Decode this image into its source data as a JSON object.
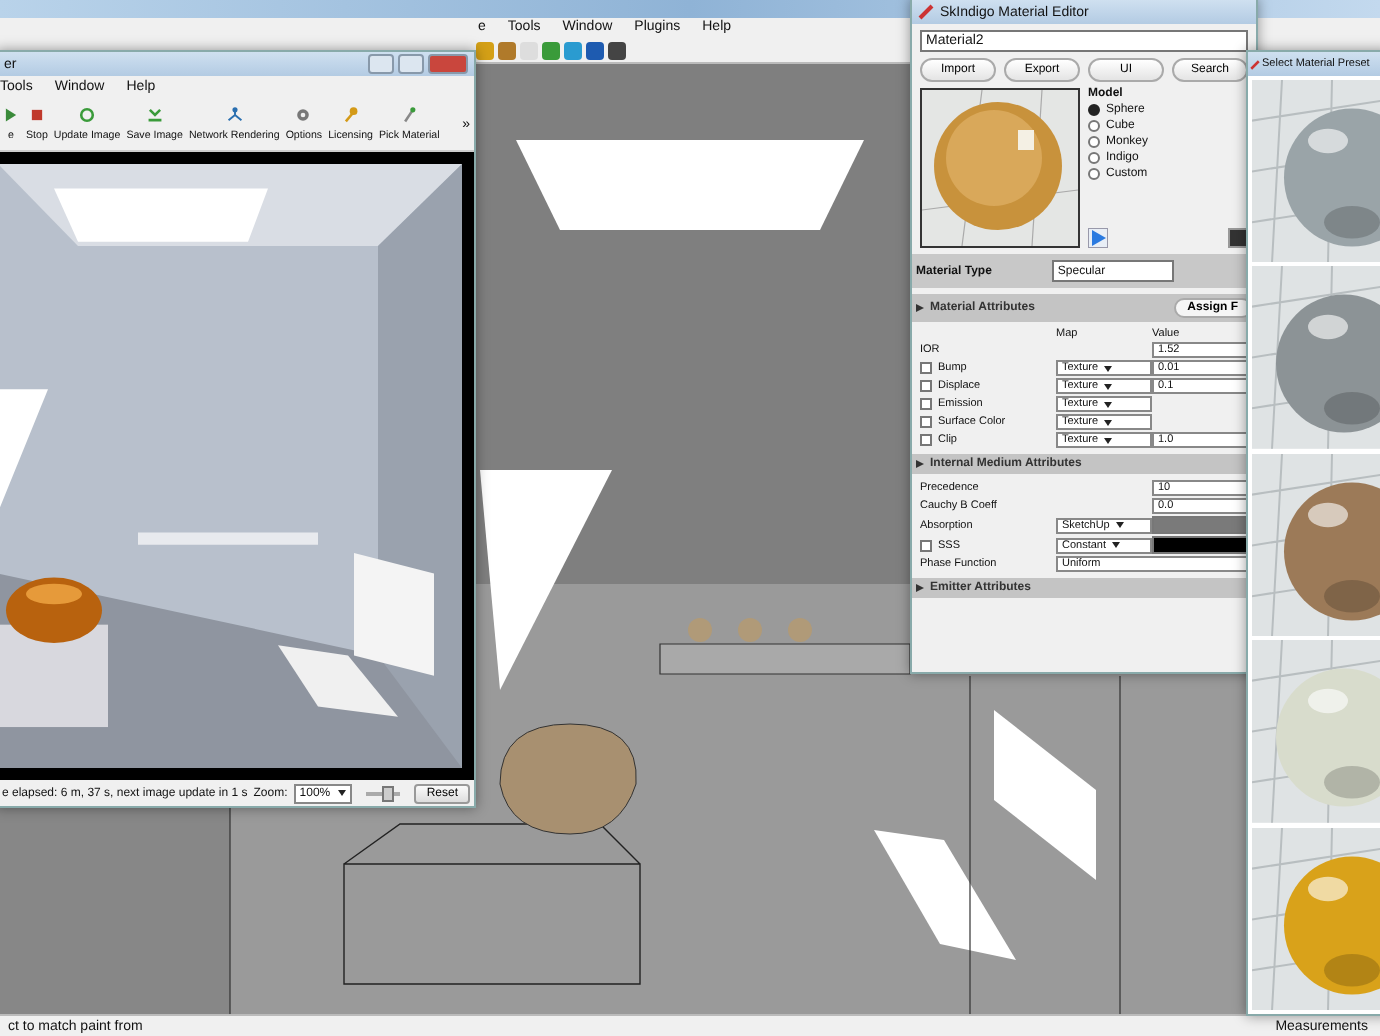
{
  "app": {
    "menu": [
      "e",
      "Tools",
      "Window",
      "Plugins",
      "Help"
    ],
    "status": "ct to match paint from",
    "measurements": "Measurements"
  },
  "render_window": {
    "title": "er",
    "menu": [
      "Tools",
      "Window",
      "Help"
    ],
    "toolbar": [
      {
        "label": "e",
        "kind": "play"
      },
      {
        "label": "Stop",
        "kind": "stop"
      },
      {
        "label": "Update Image",
        "kind": "refresh"
      },
      {
        "label": "Save Image",
        "kind": "save"
      },
      {
        "label": "Network Rendering",
        "kind": "network"
      },
      {
        "label": "Options",
        "kind": "gear"
      },
      {
        "label": "Licensing",
        "kind": "key"
      },
      {
        "label": "Pick Material",
        "kind": "pick"
      }
    ],
    "more": "»",
    "status": "e elapsed: 6 m, 37 s, next image update in 1 s",
    "zoom_label": "Zoom:",
    "zoom": "100%",
    "zoom_slider": {
      "level": 0.55
    },
    "reset": "Reset"
  },
  "material_editor": {
    "title": "SkIndigo Material Editor",
    "material": "Material2",
    "buttons": [
      "Import",
      "Export",
      "UI",
      "Search"
    ],
    "model_label": "Model",
    "models": [
      {
        "label": "Sphere",
        "selected": true
      },
      {
        "label": "Cube",
        "selected": false
      },
      {
        "label": "Monkey",
        "selected": false
      },
      {
        "label": "Indigo",
        "selected": false
      },
      {
        "label": "Custom",
        "selected": false
      }
    ],
    "type_label": "Material Type",
    "type": "Specular",
    "attributes": {
      "title": "Material Attributes",
      "assign": "Assign F",
      "map_header": "Map",
      "value_header": "Value",
      "rows": [
        {
          "label": "IOR",
          "value": "1.52"
        },
        {
          "label": "Bump",
          "checked": false,
          "map": "Texture",
          "value": "0.01"
        },
        {
          "label": "Displace",
          "checked": false,
          "map": "Texture",
          "value": "0.1"
        },
        {
          "label": "Emission",
          "checked": false,
          "map": "Texture"
        },
        {
          "label": "Surface Color",
          "checked": false,
          "map": "Texture"
        },
        {
          "label": "Clip",
          "checked": false,
          "map": "Texture",
          "value": "1.0"
        }
      ]
    },
    "medium": {
      "title": "Internal Medium Attributes",
      "rows": [
        {
          "label": "Precedence",
          "value": "10"
        },
        {
          "label": "Cauchy B Coeff",
          "value": "0.0"
        },
        {
          "label": "Absorption",
          "map": "SketchUp",
          "color": "#7a7a7a"
        },
        {
          "label": "SSS",
          "checked": false,
          "map": "Constant",
          "color": "#000000"
        },
        {
          "label": "Phase Function",
          "text": "Uniform"
        }
      ]
    },
    "emitter": {
      "title": "Emitter Attributes"
    }
  },
  "preset_window": {
    "title": "Select Material Preset"
  }
}
